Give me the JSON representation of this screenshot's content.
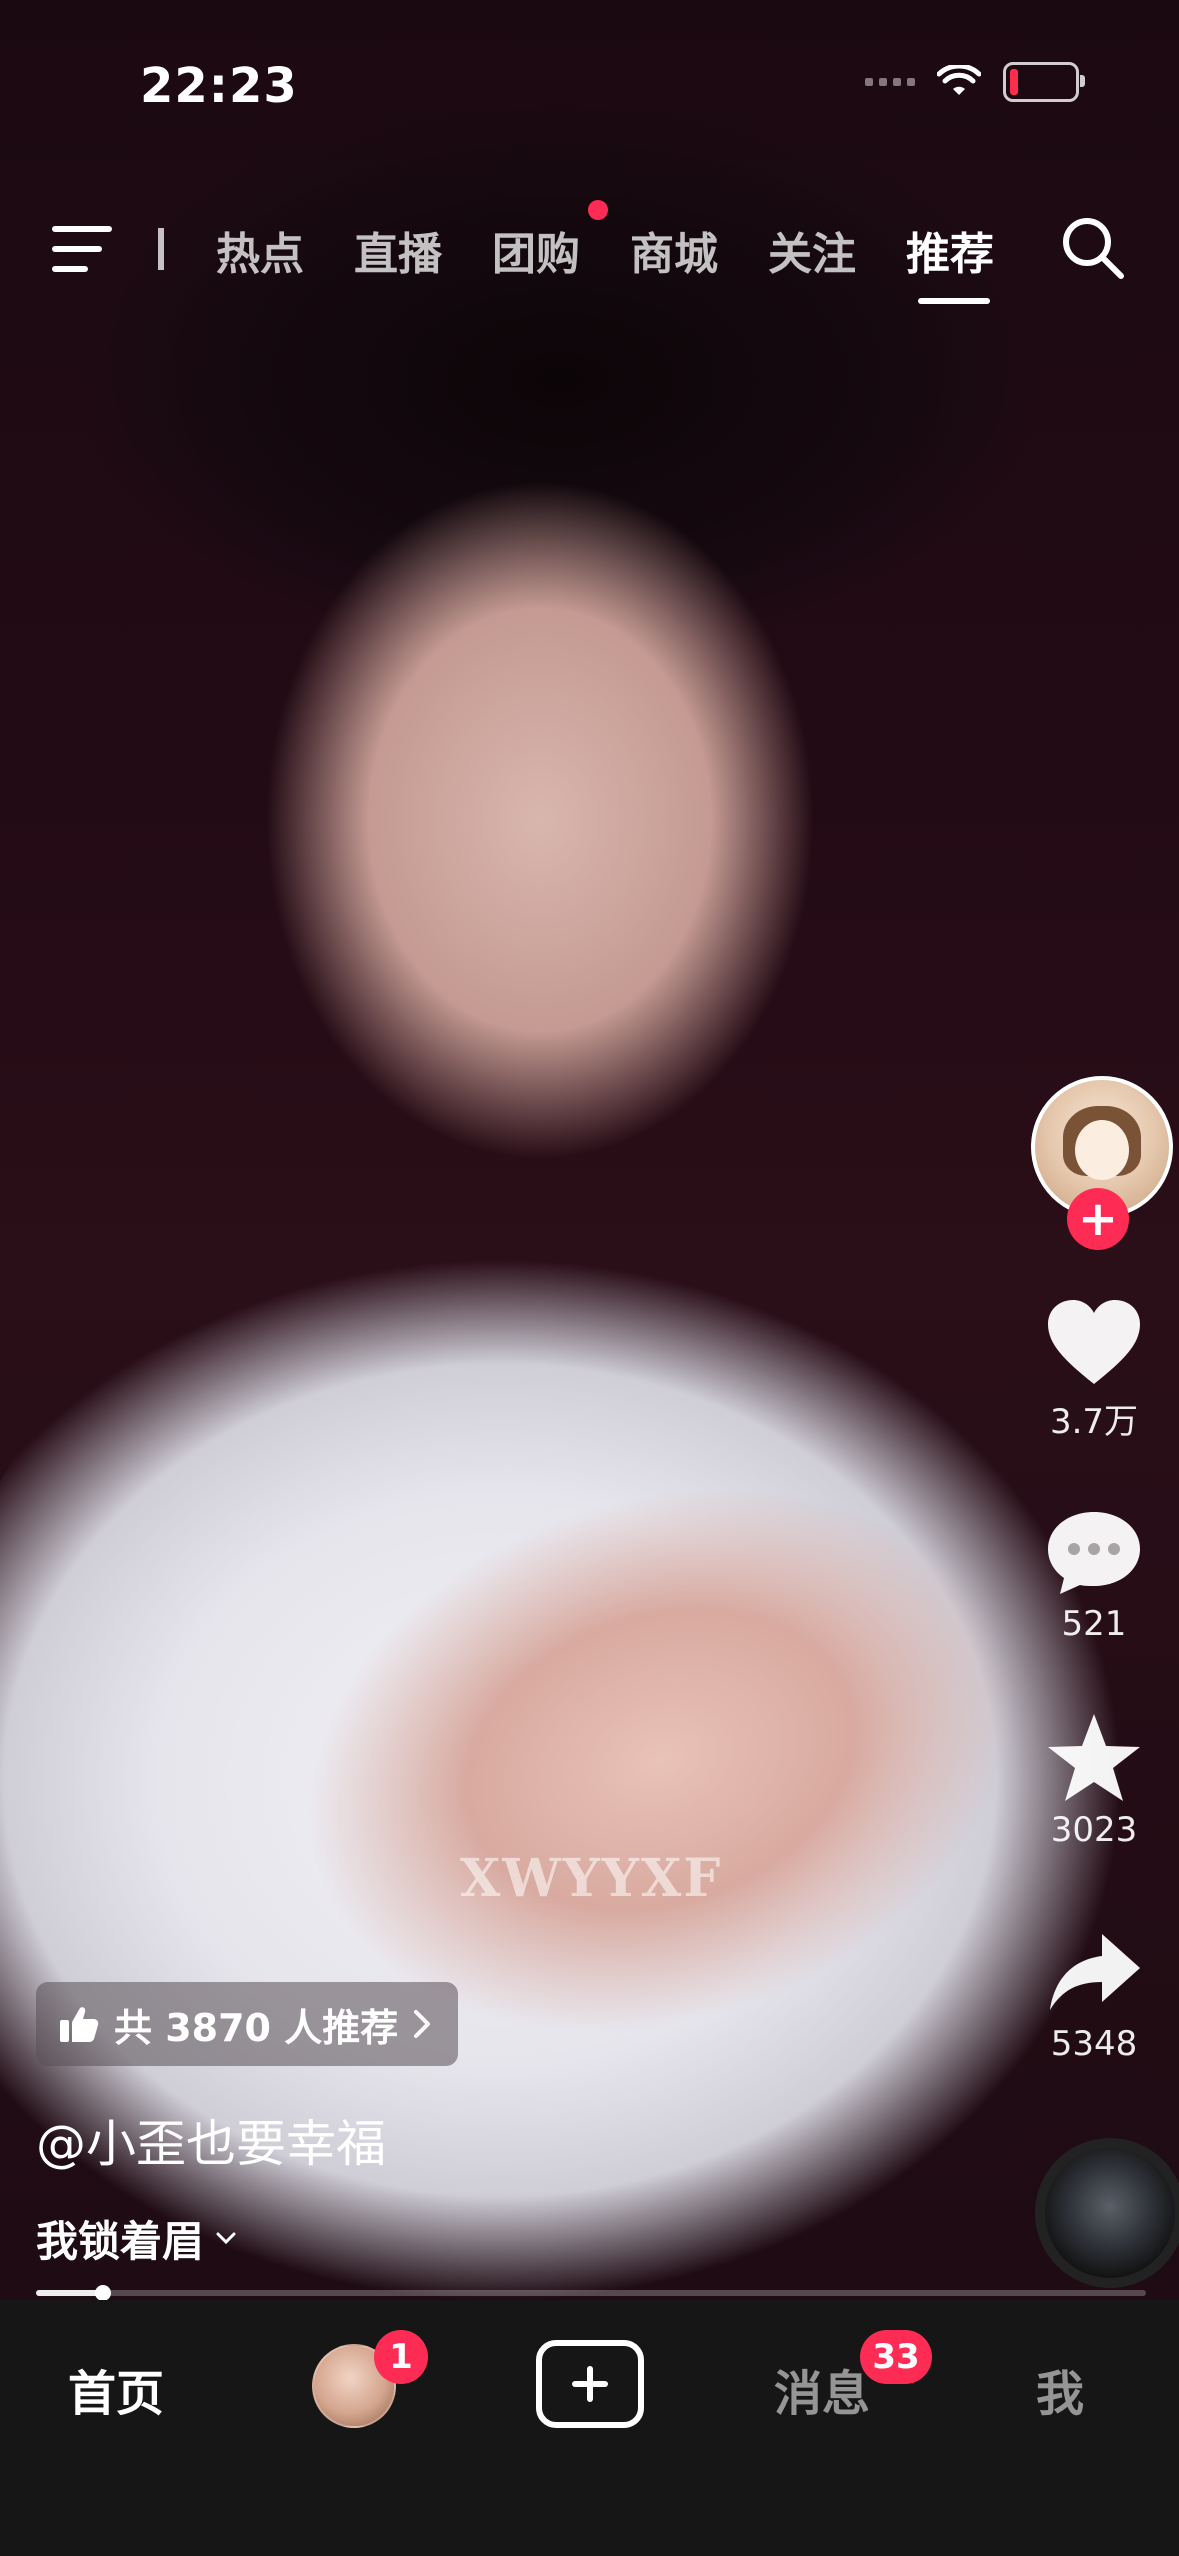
{
  "status_bar": {
    "time": "22:23"
  },
  "top_nav": {
    "tabs": [
      {
        "label": "热点"
      },
      {
        "label": "直播"
      },
      {
        "label": "团购"
      },
      {
        "label": "商城"
      },
      {
        "label": "关注"
      },
      {
        "label": "推荐"
      }
    ],
    "active_tab": "推荐"
  },
  "video": {
    "watermark": "XWYYXF"
  },
  "actions": {
    "likes": "3.7万",
    "comments": "521",
    "favorites": "3023",
    "shares": "5348"
  },
  "info": {
    "recommend_text": "共 3870 人推荐",
    "author": "@小歪也要幸福",
    "music": "我锁着眉"
  },
  "progress": {
    "played_fraction": 0.06
  },
  "bottom_nav": {
    "home": "首页",
    "friend_badge": "1",
    "messages": "消息",
    "messages_badge": "33",
    "me": "我"
  },
  "colors": {
    "accent": "#fe2c55",
    "bottom_bar": "#161616"
  },
  "icons": [
    "menu-icon",
    "search-icon",
    "heart-icon",
    "comment-icon",
    "star-icon",
    "share-icon",
    "thumbs-up-icon",
    "chevron-right-icon",
    "chevron-down-icon",
    "plus-icon",
    "wifi-icon",
    "battery-icon"
  ]
}
